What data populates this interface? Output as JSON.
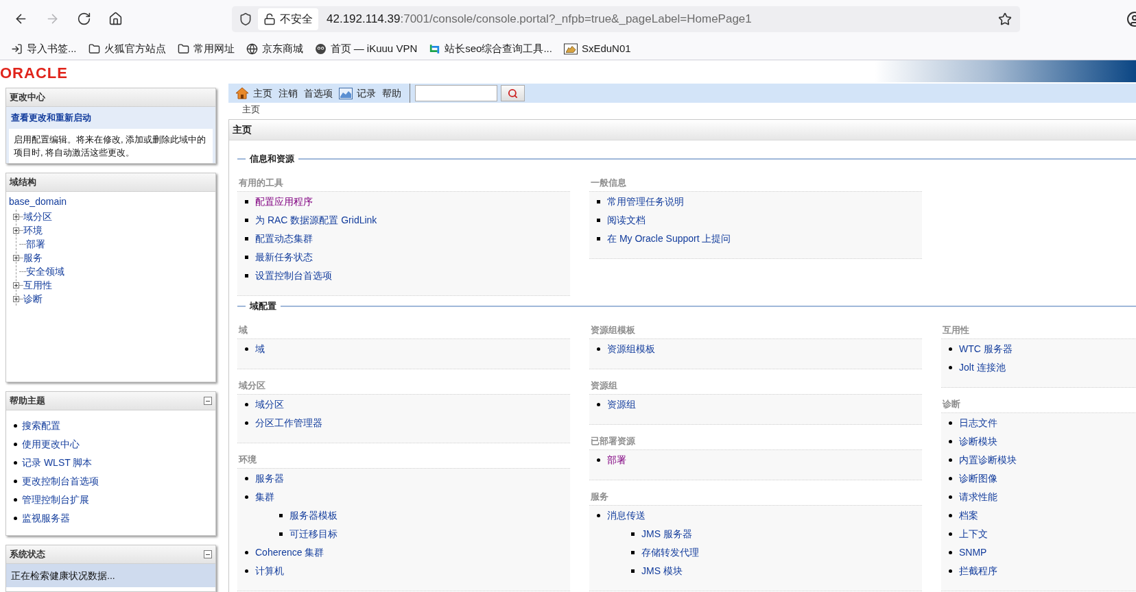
{
  "browser": {
    "nav_buttons": [
      {
        "kind": "back",
        "disabled": false
      },
      {
        "kind": "forward",
        "disabled": true
      },
      {
        "kind": "reload",
        "disabled": false
      },
      {
        "kind": "home",
        "disabled": false
      }
    ],
    "security_label": "不安全",
    "url_host": "42.192.114.39",
    "url_rest": ":7001/console/console.portal?_nfpb=true&_pageLabel=HomePage1",
    "bookmarks": [
      {
        "kind": "import",
        "label": "导入书签..."
      },
      {
        "kind": "folder",
        "label": "火狐官方站点"
      },
      {
        "kind": "folder",
        "label": "常用网址"
      },
      {
        "kind": "globe",
        "label": "京东商城"
      },
      {
        "kind": "mascot",
        "label": "首页 — iKuuu VPN"
      },
      {
        "kind": "arrows",
        "label": "站长seo综合查询工具..."
      },
      {
        "kind": "cat",
        "label": "SxEduN01"
      }
    ]
  },
  "logo": "ORACLE",
  "change_center": {
    "title": "更改中心",
    "link": "查看更改和重新启动",
    "description": "启用配置编辑。将来在修改, 添加或删除此域中的项目时, 将自动激活这些更改。"
  },
  "domain_structure": {
    "title": "域结构",
    "root": "base_domain",
    "children": [
      {
        "label": "域分区",
        "kind": "branch"
      },
      {
        "label": "环境",
        "kind": "branch"
      },
      {
        "label": "部署",
        "kind": "leaf"
      },
      {
        "label": "服务",
        "kind": "branch"
      },
      {
        "label": "安全领域",
        "kind": "leaf"
      },
      {
        "label": "互用性",
        "kind": "branch"
      },
      {
        "label": "诊断",
        "kind": "branch"
      }
    ]
  },
  "help_topics": {
    "title": "帮助主题",
    "expanded": true,
    "items": [
      "搜索配置",
      "使用更改中心",
      "记录 WLST 脚本",
      "更改控制台首选项",
      "管理控制台扩展",
      "监视服务器"
    ]
  },
  "system_status": {
    "title": "系统状态",
    "expanded": true,
    "message": "正在检索健康状况数据..."
  },
  "toolbar": {
    "items": [
      {
        "label": "主页",
        "kind": "home"
      },
      {
        "label": "注销",
        "kind": "plain"
      },
      {
        "label": "首选项",
        "kind": "plain"
      },
      {
        "label": "记录",
        "kind": "chart"
      },
      {
        "label": "帮助",
        "kind": "plain"
      }
    ]
  },
  "breadcrumb": "主页",
  "panel_title": "主页",
  "sections": [
    {
      "title": "信息和资源",
      "columns": [
        [
          {
            "title": "有用的工具",
            "kind": "square",
            "items": [
              {
                "label": "配置应用程序",
                "visited": true
              },
              {
                "label": "为 RAC 数据源配置 GridLink",
                "visited": false
              },
              {
                "label": "配置动态集群",
                "visited": false
              },
              {
                "label": "最新任务状态",
                "visited": false
              },
              {
                "label": "设置控制台首选项",
                "visited": false
              }
            ]
          }
        ],
        [
          {
            "title": "一般信息",
            "kind": "square",
            "items": [
              {
                "label": "常用管理任务说明",
                "visited": false
              },
              {
                "label": "阅读文档",
                "visited": false
              },
              {
                "label": "在 My Oracle Support 上提问",
                "visited": false
              }
            ]
          }
        ]
      ]
    },
    {
      "title": "域配置",
      "columns": [
        [
          {
            "title": "域",
            "kind": "disc",
            "items": [
              {
                "label": "域",
                "visited": false
              }
            ]
          },
          {
            "title": "域分区",
            "kind": "disc",
            "items": [
              {
                "label": "域分区",
                "visited": false
              },
              {
                "label": "分区工作管理器",
                "visited": false
              }
            ]
          },
          {
            "title": "环境",
            "kind": "disc",
            "items": [
              {
                "label": "服务器",
                "visited": false
              },
              {
                "label": "集群",
                "visited": false,
                "children": [
                  {
                    "label": "服务器模板",
                    "visited": false
                  },
                  {
                    "label": "可迁移目标",
                    "visited": false
                  }
                ]
              },
              {
                "label": "Coherence 集群",
                "visited": false
              },
              {
                "label": "计算机",
                "visited": false
              }
            ]
          }
        ],
        [
          {
            "title": "资源组模板",
            "kind": "disc",
            "items": [
              {
                "label": "资源组模板",
                "visited": false
              }
            ]
          },
          {
            "title": "资源组",
            "kind": "disc",
            "items": [
              {
                "label": "资源组",
                "visited": false
              }
            ]
          },
          {
            "title": "已部署资源",
            "kind": "disc",
            "items": [
              {
                "label": "部署",
                "visited": true
              }
            ]
          },
          {
            "title": "服务",
            "kind": "disc",
            "items": [
              {
                "label": "消息传送",
                "visited": false,
                "children": [
                  {
                    "label": "JMS 服务器",
                    "visited": false
                  },
                  {
                    "label": "存储转发代理",
                    "visited": false
                  },
                  {
                    "label": "JMS 模块",
                    "visited": false
                  }
                ]
              }
            ]
          }
        ],
        [
          {
            "title": "互用性",
            "kind": "disc",
            "items": [
              {
                "label": "WTC 服务器",
                "visited": false
              },
              {
                "label": "Jolt 连接池",
                "visited": false
              }
            ]
          },
          {
            "title": "诊断",
            "kind": "disc",
            "items": [
              {
                "label": "日志文件",
                "visited": false
              },
              {
                "label": "诊断模块",
                "visited": false
              },
              {
                "label": "内置诊断模块",
                "visited": false
              },
              {
                "label": "诊断图像",
                "visited": false
              },
              {
                "label": "请求性能",
                "visited": false
              },
              {
                "label": "档案",
                "visited": false
              },
              {
                "label": "上下文",
                "visited": false
              },
              {
                "label": "SNMP",
                "visited": false
              },
              {
                "label": "拦截程序",
                "visited": false
              }
            ]
          }
        ]
      ]
    }
  ]
}
